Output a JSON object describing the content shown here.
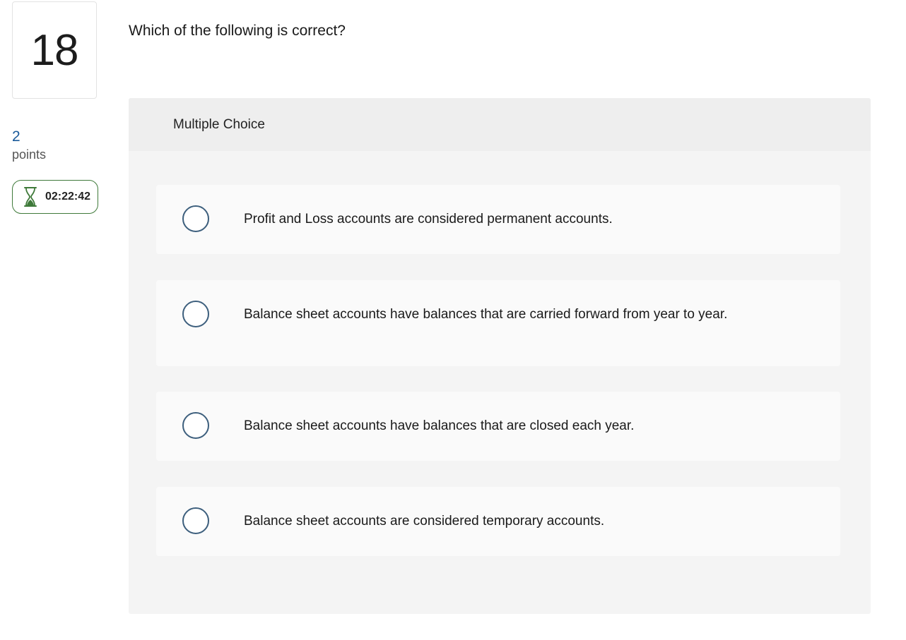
{
  "question": {
    "number": "18",
    "points_value": "2",
    "points_label": "points",
    "timer": "02:22:42",
    "prompt": "Which of the following is correct?"
  },
  "answer_panel": {
    "type_label": "Multiple Choice",
    "choices": [
      {
        "label": "Profit and Loss accounts are considered permanent accounts."
      },
      {
        "label": "Balance sheet accounts have balances that are carried forward from year to year."
      },
      {
        "label": "Balance sheet accounts have balances that are closed each year."
      },
      {
        "label": "Balance sheet accounts are considered temporary accounts."
      }
    ]
  },
  "colors": {
    "points": "#1a5a9a",
    "timer_border": "#3f7a3a",
    "hourglass": "#3f7a3a",
    "radio_border": "#3d5f7d",
    "panel_bg": "#f4f4f4",
    "choice_bg": "#fafafa"
  },
  "icons": {
    "timer_icon": "hourglass-icon",
    "choice_control": "radio-button"
  }
}
